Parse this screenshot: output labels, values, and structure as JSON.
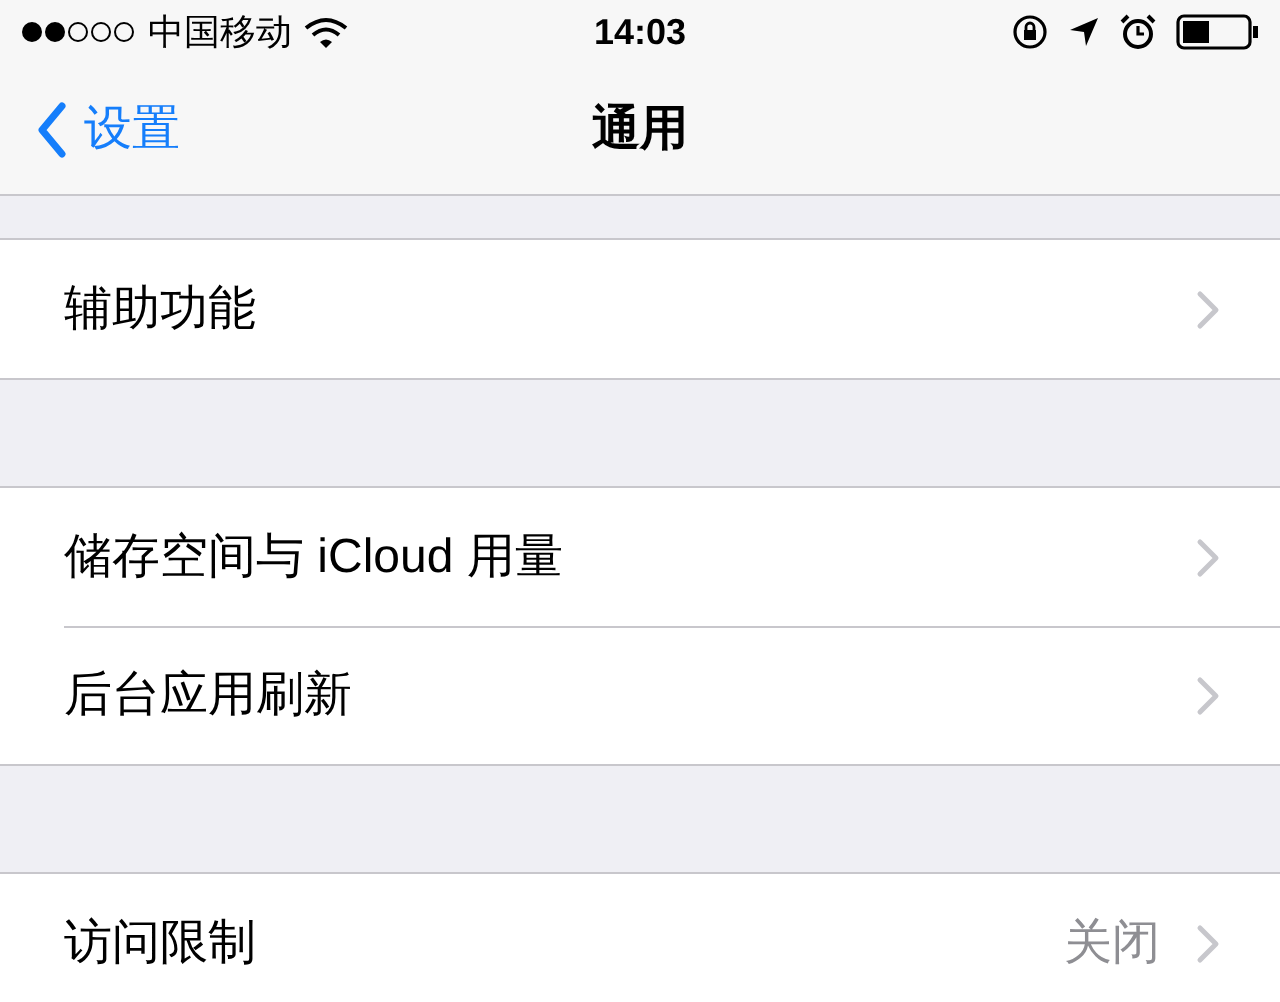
{
  "status_bar": {
    "carrier": "中国移动",
    "time": "14:03"
  },
  "nav": {
    "back": "设置",
    "title": "通用"
  },
  "sections": [
    {
      "rows": [
        {
          "label": "辅助功能"
        }
      ]
    },
    {
      "rows": [
        {
          "label": "储存空间与 iCloud 用量"
        },
        {
          "label": "后台应用刷新"
        }
      ]
    },
    {
      "rows": [
        {
          "label": "访问限制",
          "value": "关闭"
        }
      ]
    }
  ]
}
